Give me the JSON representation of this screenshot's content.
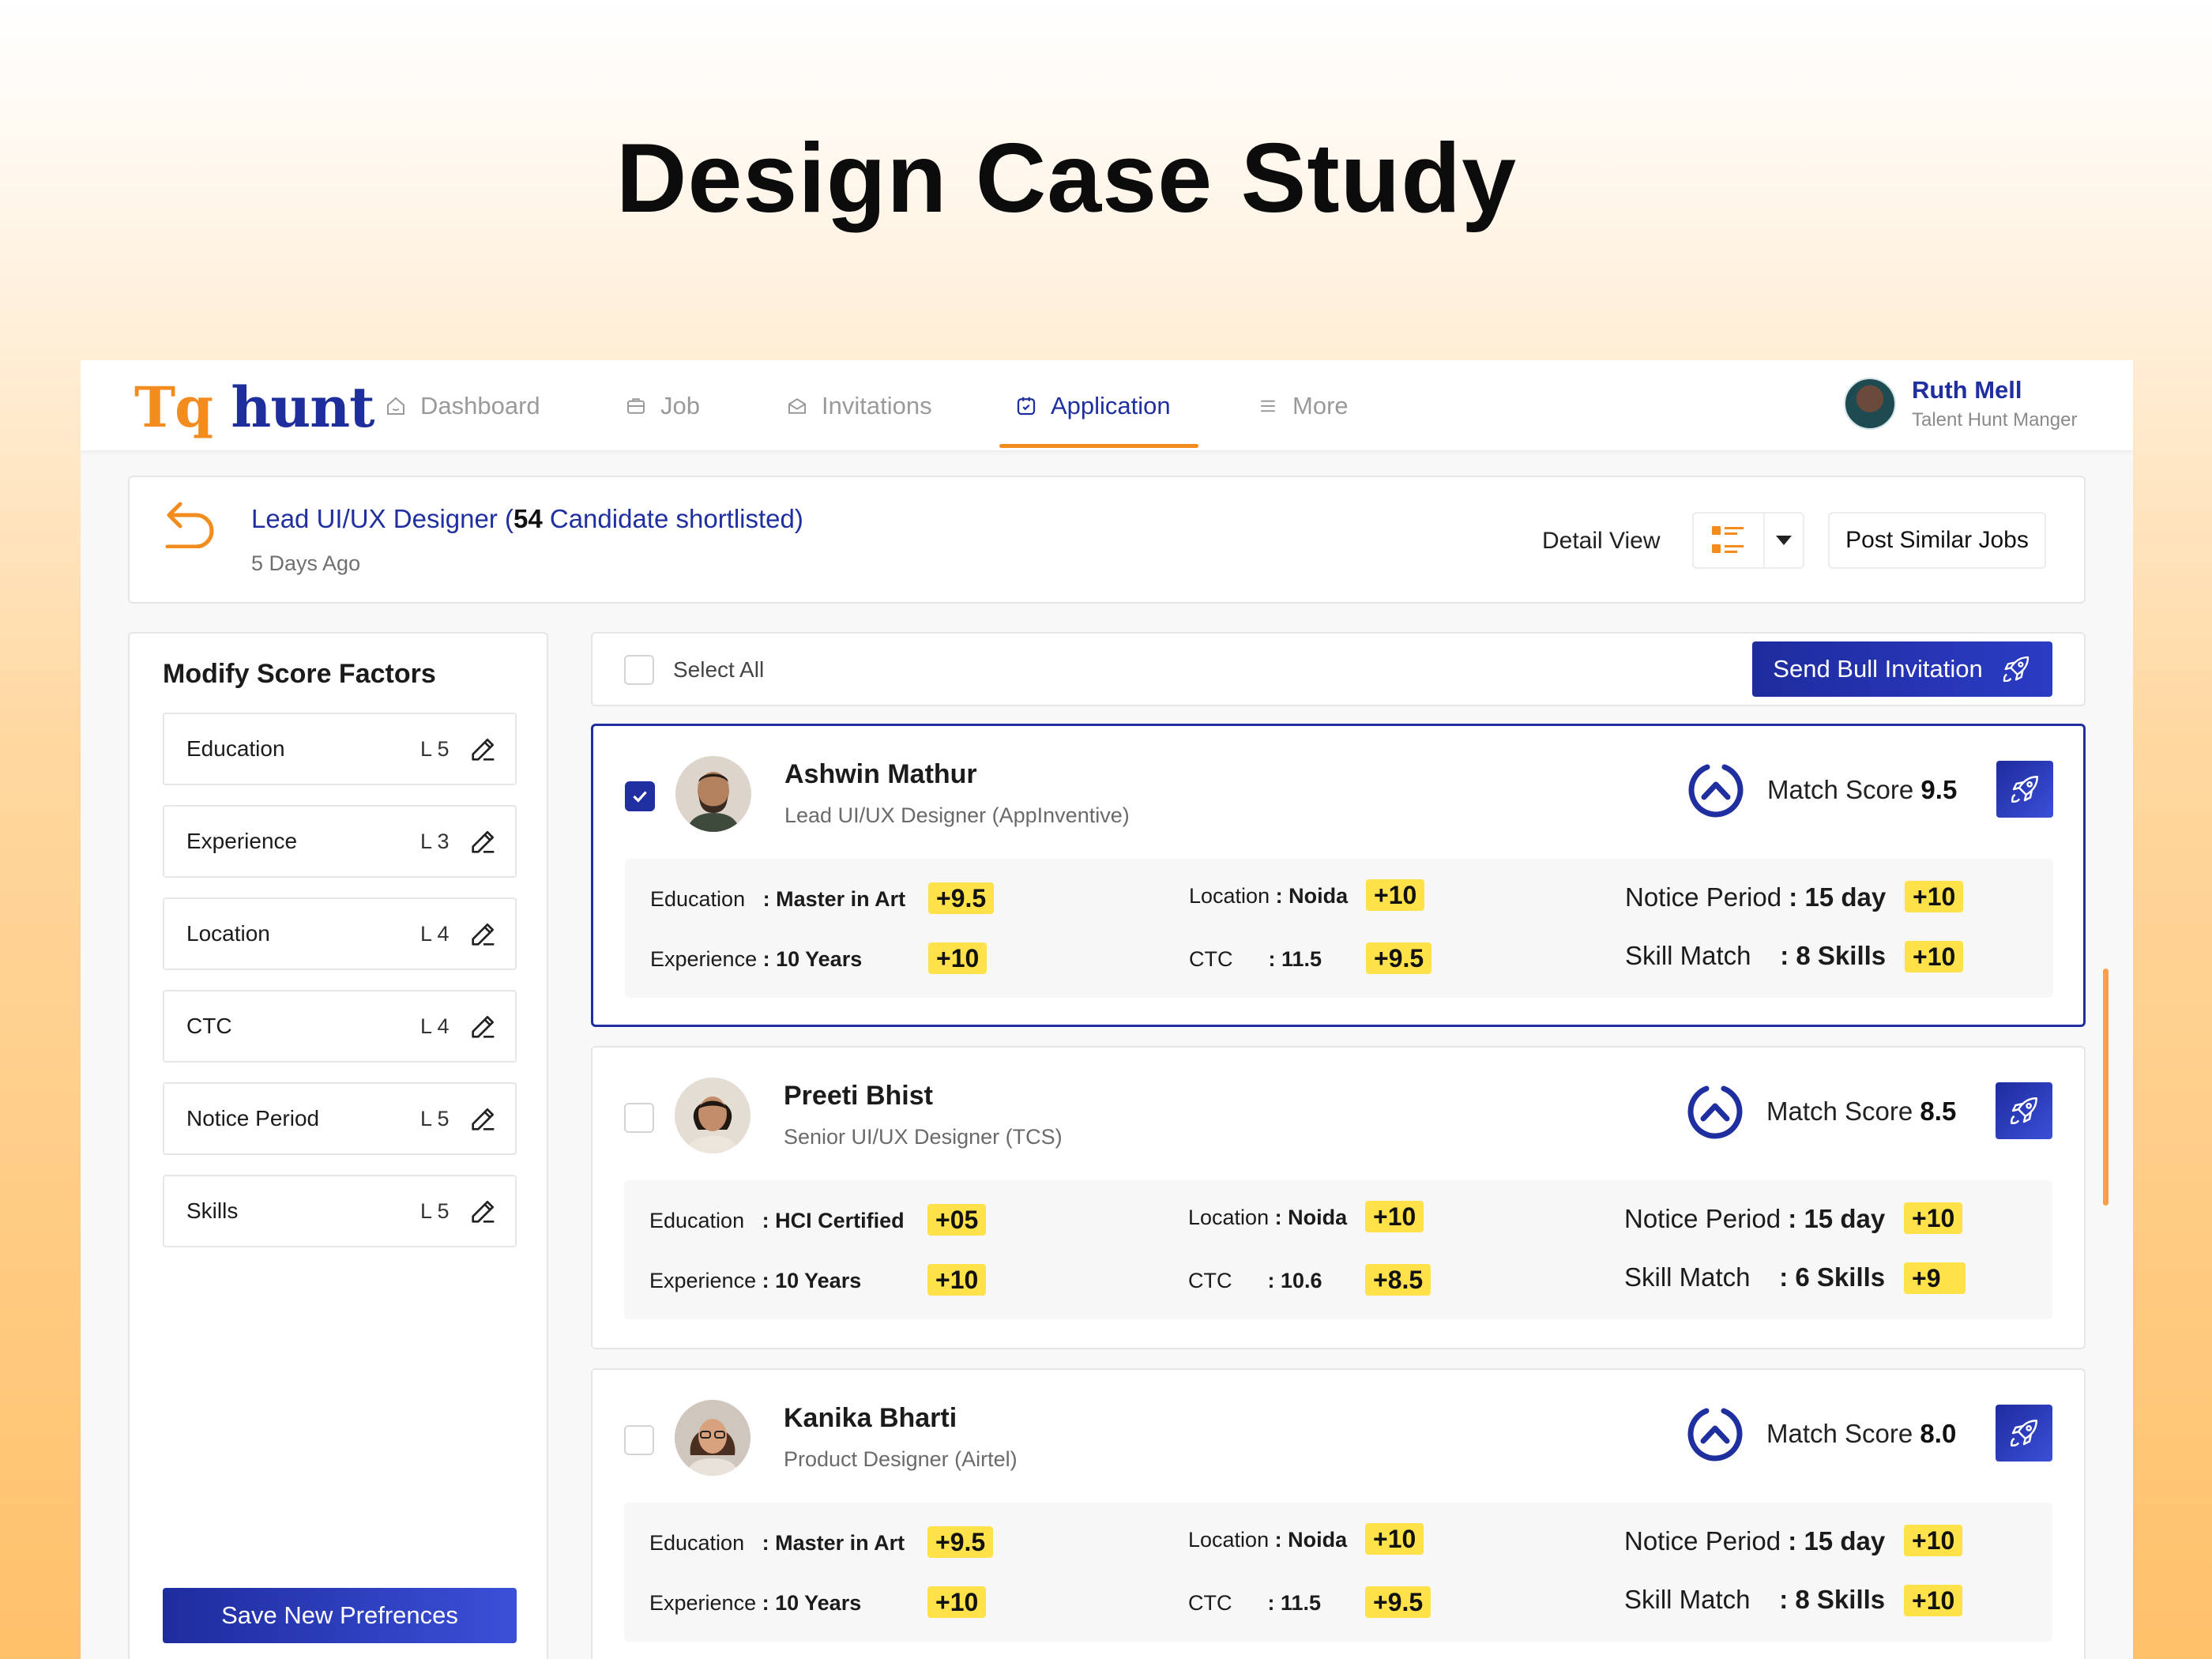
{
  "hero": {
    "title": "Design Case Study"
  },
  "brand": {
    "logo_a": "Tq",
    "logo_b": "hunt",
    "accent": "#f28c1e",
    "primary": "#1f2fa0"
  },
  "nav": {
    "items": [
      {
        "label": "Dashboard",
        "icon": "home-icon"
      },
      {
        "label": "Job",
        "icon": "briefcase-icon"
      },
      {
        "label": "Invitations",
        "icon": "mail-icon"
      },
      {
        "label": "Application",
        "icon": "calendar-check-icon",
        "active": true
      },
      {
        "label": "More",
        "icon": "menu-icon"
      }
    ]
  },
  "user": {
    "name": "Ruth Mell",
    "role": "Talent Hunt Manger"
  },
  "job": {
    "title_prefix": "Lead UI/UX Designer (",
    "count": "54",
    "title_suffix": " Candidate shortlisted)",
    "posted": "5 Days Ago",
    "detail_view_label": "Detail View",
    "post_similar_label": "Post Similar Jobs"
  },
  "score_factors": {
    "title": "Modify Score Factors",
    "items": [
      {
        "label": "Education",
        "level": "L 5"
      },
      {
        "label": "Experience",
        "level": "L 3"
      },
      {
        "label": "Location",
        "level": "L 4"
      },
      {
        "label": "CTC",
        "level": "L 4"
      },
      {
        "label": "Notice Period",
        "level": "L 5"
      },
      {
        "label": "Skills",
        "level": "L 5"
      }
    ],
    "save_label": "Save New Prefrences"
  },
  "list": {
    "select_all_label": "Select All",
    "bulk_label": "Send Bull Invitation"
  },
  "candidates": [
    {
      "name": "Ashwin Mathur",
      "role": "Lead UI/UX Designer (AppInventive)",
      "selected": true,
      "match_label": "Match Score ",
      "match_score": "9.5",
      "education_label": "Education",
      "education": ": Master in Art",
      "education_score": "+9.5",
      "experience_label": "Experience",
      "experience": ": 10 Years",
      "experience_score": "+10",
      "location_label": "Location",
      "location": ": Noida",
      "location_score": "+10",
      "ctc_label": "CTC",
      "ctc": ": 11.5",
      "ctc_score": "+9.5",
      "notice_label": "Notice Period",
      "notice": ": 15 day",
      "notice_score": "+10",
      "skill_label": "Skill Match",
      "skill": ": 8 Skills",
      "skill_score": "+10"
    },
    {
      "name": "Preeti Bhist",
      "role": "Senior UI/UX Designer (TCS)",
      "selected": false,
      "match_label": "Match Score ",
      "match_score": "8.5",
      "education_label": "Education",
      "education": ": HCI Certified",
      "education_score": "+05",
      "experience_label": "Experience",
      "experience": ": 10 Years",
      "experience_score": "+10",
      "location_label": "Location",
      "location": ": Noida",
      "location_score": "+10",
      "ctc_label": "CTC",
      "ctc": ": 10.6",
      "ctc_score": "+8.5",
      "notice_label": "Notice Period",
      "notice": ": 15 day",
      "notice_score": "+10",
      "skill_label": "Skill Match",
      "skill": ": 6 Skills",
      "skill_score": "+9"
    },
    {
      "name": "Kanika Bharti",
      "role": "Product Designer (Airtel)",
      "selected": false,
      "match_label": "Match Score ",
      "match_score": "8.0",
      "education_label": "Education",
      "education": ": Master in Art",
      "education_score": "+9.5",
      "experience_label": "Experience",
      "experience": ": 10 Years",
      "experience_score": "+10",
      "location_label": "Location",
      "location": ": Noida",
      "location_score": "+10",
      "ctc_label": "CTC",
      "ctc": ": 11.5",
      "ctc_score": "+9.5",
      "notice_label": "Notice Period",
      "notice": ": 15 day",
      "notice_score": "+10",
      "skill_label": "Skill Match",
      "skill": ": 8 Skills",
      "skill_score": "+10"
    }
  ]
}
